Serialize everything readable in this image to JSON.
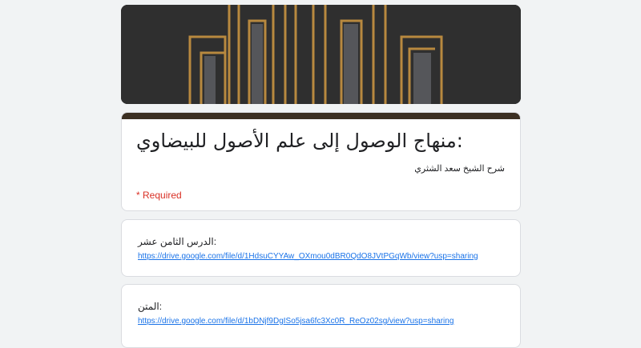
{
  "form": {
    "title": "منهاج الوصول إلى علم الأصول للبيضاوي:",
    "description": "شرح الشيخ سعد الشثري",
    "required_note": "* Required",
    "banner_color": "#2e2e2e",
    "accent_color": "#3b2f22",
    "banner_icon": "gold-arches-image"
  },
  "items": [
    {
      "label": "الدرس الثامن عشر:",
      "link": "https://drive.google.com/file/d/1HdsuCYYAw_OXmou0dBR0QdO8JVtPGqWb/view?usp=sharing"
    },
    {
      "label": "المتن:",
      "link": "https://drive.google.com/file/d/1bDNjf9DgISo5jsa6fc3Xc0R_ReOz02sg/view?usp=sharing"
    }
  ]
}
